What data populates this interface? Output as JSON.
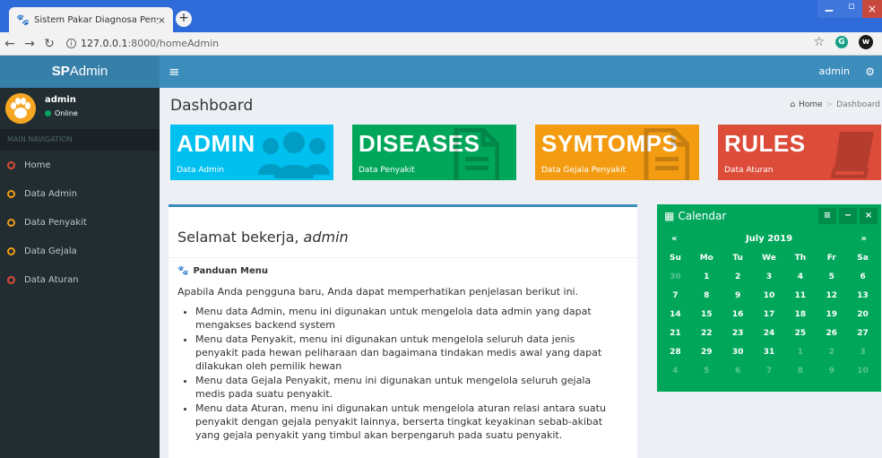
{
  "browser": {
    "tab_title": "Sistem Pakar Diagnosa Penyakit",
    "tab_close": "×",
    "new_tab": "+",
    "url_host": "127.0.0.1",
    "url_path": ":8000/homeAdmin",
    "ext_w": "w",
    "ext_g": "G"
  },
  "header": {
    "logo_bold": "SP",
    "logo_rest": "Admin",
    "menu_icon": "≡",
    "user": "admin"
  },
  "sidebar": {
    "user_name": "admin",
    "user_status": "Online",
    "nav_header": "MAIN NAVIGATION",
    "items": [
      {
        "label": "Home",
        "color": "#dd4b39"
      },
      {
        "label": "Data Admin",
        "color": "#f39c12"
      },
      {
        "label": "Data Penyakit",
        "color": "#f39c12"
      },
      {
        "label": "Data Gejala",
        "color": "#f39c12"
      },
      {
        "label": "Data Aturan",
        "color": "#dd4b39"
      }
    ]
  },
  "page": {
    "title": "Dashboard",
    "breadcrumb_home": "Home",
    "breadcrumb_sep": ">",
    "breadcrumb_current": "Dashboard"
  },
  "boxes": [
    {
      "title": "ADMIN",
      "subtitle": "Data Admin",
      "color": "#00c0ef",
      "icon": "users-icon"
    },
    {
      "title": "DISEASES",
      "subtitle": "Data Penyakit",
      "color": "#00a65a",
      "icon": "document-icon"
    },
    {
      "title": "SYMTOMPS",
      "subtitle": "Data Gejala Penyakit",
      "color": "#f39c12",
      "icon": "document-icon"
    },
    {
      "title": "RULES",
      "subtitle": "Data Aturan",
      "color": "#dd4b39",
      "icon": "book-icon"
    }
  ],
  "main": {
    "welcome_prefix": "Selamat bekerja, ",
    "welcome_name": "admin",
    "guide_title": "Panduan Menu",
    "intro": "Apabila Anda pengguna baru, Anda dapat memperhatikan penjelasan berikut ini.",
    "items": [
      "Menu data Admin, menu ini digunakan untuk mengelola data admin yang dapat mengakses backend system",
      "Menu data Penyakit, menu ini digunakan untuk mengelola seluruh data jenis penyakit pada hewan peliharaan dan bagaimana tindakan medis awal yang dapat dilakukan oleh pemilik hewan",
      "Menu data Gejala Penyakit, menu ini digunakan untuk mengelola seluruh gejala medis pada suatu penyakit.",
      "Menu data Aturan, menu ini digunakan untuk mengelola aturan relasi antara suatu penyakit dengan gejala penyakit lainnya, berserta tingkat keyakinan sebab-akibat yang gejala penyakit yang timbul akan berpengaruh pada suatu penyakit."
    ]
  },
  "calendar": {
    "title": "Calendar",
    "month": "July 2019",
    "prev": "«",
    "next": "»",
    "tool_menu": "≡",
    "tool_min": "−",
    "tool_close": "×",
    "days": [
      "Su",
      "Mo",
      "Tu",
      "We",
      "Th",
      "Fr",
      "Sa"
    ],
    "weeks": [
      [
        "30",
        "1",
        "2",
        "3",
        "4",
        "5",
        "6"
      ],
      [
        "7",
        "8",
        "9",
        "10",
        "11",
        "12",
        "13"
      ],
      [
        "14",
        "15",
        "16",
        "17",
        "18",
        "19",
        "20"
      ],
      [
        "21",
        "22",
        "23",
        "24",
        "25",
        "26",
        "27"
      ],
      [
        "28",
        "29",
        "30",
        "31",
        "1",
        "2",
        "3"
      ],
      [
        "4",
        "5",
        "6",
        "7",
        "8",
        "9",
        "10"
      ]
    ]
  }
}
